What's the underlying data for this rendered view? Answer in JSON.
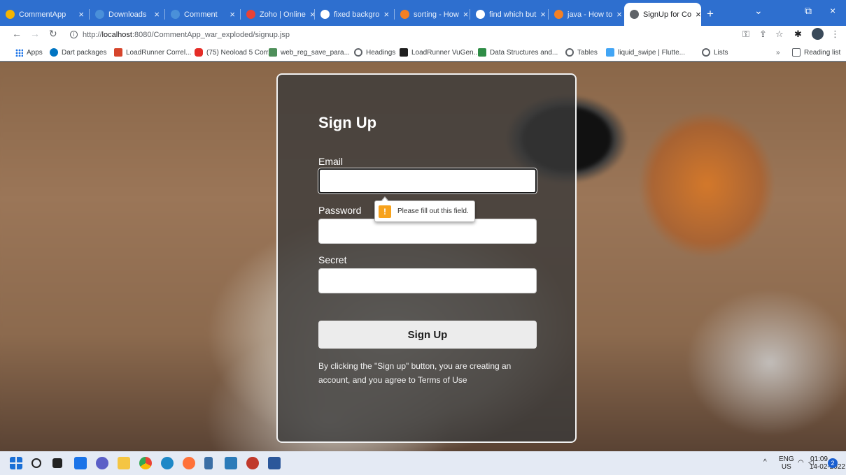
{
  "tabs": [
    {
      "label": "CommentApp",
      "close": "×",
      "color": "#f4b400"
    },
    {
      "label": "Downloads",
      "close": "×",
      "color": "#4a90d9"
    },
    {
      "label": "Comment",
      "close": "×",
      "color": "#4a90d9"
    },
    {
      "label": "Zoho | Online",
      "close": "×",
      "color": "#e94235"
    },
    {
      "label": "fixed backgro",
      "close": "×",
      "color": "#ffffff"
    },
    {
      "label": "sorting - How",
      "close": "×",
      "color": "#f48024"
    },
    {
      "label": "find which but",
      "close": "×",
      "color": "#ffffff"
    },
    {
      "label": "java - How to",
      "close": "×",
      "color": "#f48024"
    },
    {
      "label": "SignUp for Co",
      "close": "×",
      "color": "#5f6368"
    }
  ],
  "window_controls": {
    "minimize": "⌄",
    "restore": "⧉",
    "close": "×"
  },
  "address": {
    "scheme": "http://",
    "host": "localhost",
    "rest": ":8080/CommentApp_war_exploded/signup.jsp"
  },
  "bookmarks": [
    {
      "label": "Apps"
    },
    {
      "label": "Dart packages"
    },
    {
      "label": "LoadRunner Correl..."
    },
    {
      "label": "(75) Neoload 5 Corr..."
    },
    {
      "label": "web_reg_save_para..."
    },
    {
      "label": "Headings"
    },
    {
      "label": "LoadRunner VuGen..."
    },
    {
      "label": "Data Structures and..."
    },
    {
      "label": "Tables"
    },
    {
      "label": "liquid_swipe | Flutte..."
    },
    {
      "label": "Lists"
    }
  ],
  "reading_list": "Reading list",
  "form": {
    "title": "Sign Up",
    "email_label": "Email",
    "email_value": "",
    "password_label": "Password",
    "password_value": "",
    "secret_label": "Secret",
    "secret_value": "",
    "submit_label": "Sign Up",
    "terms_text": "By clicking the \"Sign up\" button, you are creating an account, and you agree to Terms of Use",
    "validation_message": "Please fill out this field.",
    "validation_icon": "!"
  },
  "system_tray": {
    "language": "ENG",
    "region": "US",
    "time": "01:09",
    "date": "14-02-2022",
    "notifications": "2"
  },
  "colors": {
    "tab_strip": "#2e6fcf",
    "card_overlay": "#3a3a3a",
    "submit_bg": "#ececec",
    "warning": "#f7a21c"
  }
}
